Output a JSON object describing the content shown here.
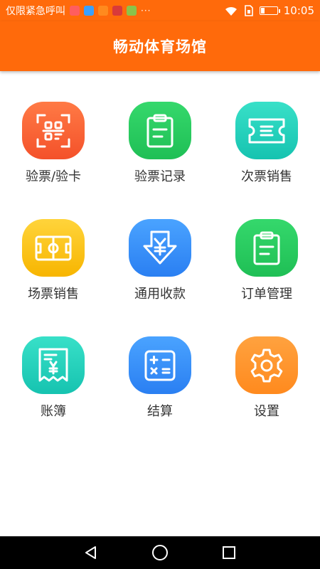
{
  "status_bar": {
    "carrier": "仅限紧急呼叫",
    "app_icons": [
      "#ff5e5e",
      "#3aa0ff",
      "#ff8a1e",
      "#d93a3a",
      "#8bc34a"
    ],
    "more": "···",
    "time": "10:05",
    "battery_level": 0.2
  },
  "app_bar": {
    "title": "畅动体育场馆"
  },
  "tiles": [
    {
      "label": "验票/验卡",
      "icon": "qr-scan-icon",
      "color_top": "#ff7a45",
      "color_bottom": "#f4512a"
    },
    {
      "label": "验票记录",
      "icon": "clipboard-icon",
      "color_top": "#35d86c",
      "color_bottom": "#1fbf55"
    },
    {
      "label": "次票销售",
      "icon": "ticket-icon",
      "color_top": "#38e0c8",
      "color_bottom": "#16c3b0"
    },
    {
      "label": "场票销售",
      "icon": "court-icon",
      "color_top": "#ffd43b",
      "color_bottom": "#f7b500"
    },
    {
      "label": "通用收款",
      "icon": "yuan-download-icon",
      "color_top": "#4aa3ff",
      "color_bottom": "#2a7ff2"
    },
    {
      "label": "订单管理",
      "icon": "clipboard-icon",
      "color_top": "#35d86c",
      "color_bottom": "#1fbf55"
    },
    {
      "label": "账簿",
      "icon": "receipt-icon",
      "color_top": "#38e0c8",
      "color_bottom": "#16c3b0"
    },
    {
      "label": "结算",
      "icon": "calculator-icon",
      "color_top": "#4aa3ff",
      "color_bottom": "#2a7ff2"
    },
    {
      "label": "设置",
      "icon": "gear-icon",
      "color_top": "#ffa23f",
      "color_bottom": "#ff8a1e"
    }
  ],
  "nav_bar": {
    "buttons": [
      "back-icon",
      "home-icon",
      "recents-icon"
    ]
  }
}
